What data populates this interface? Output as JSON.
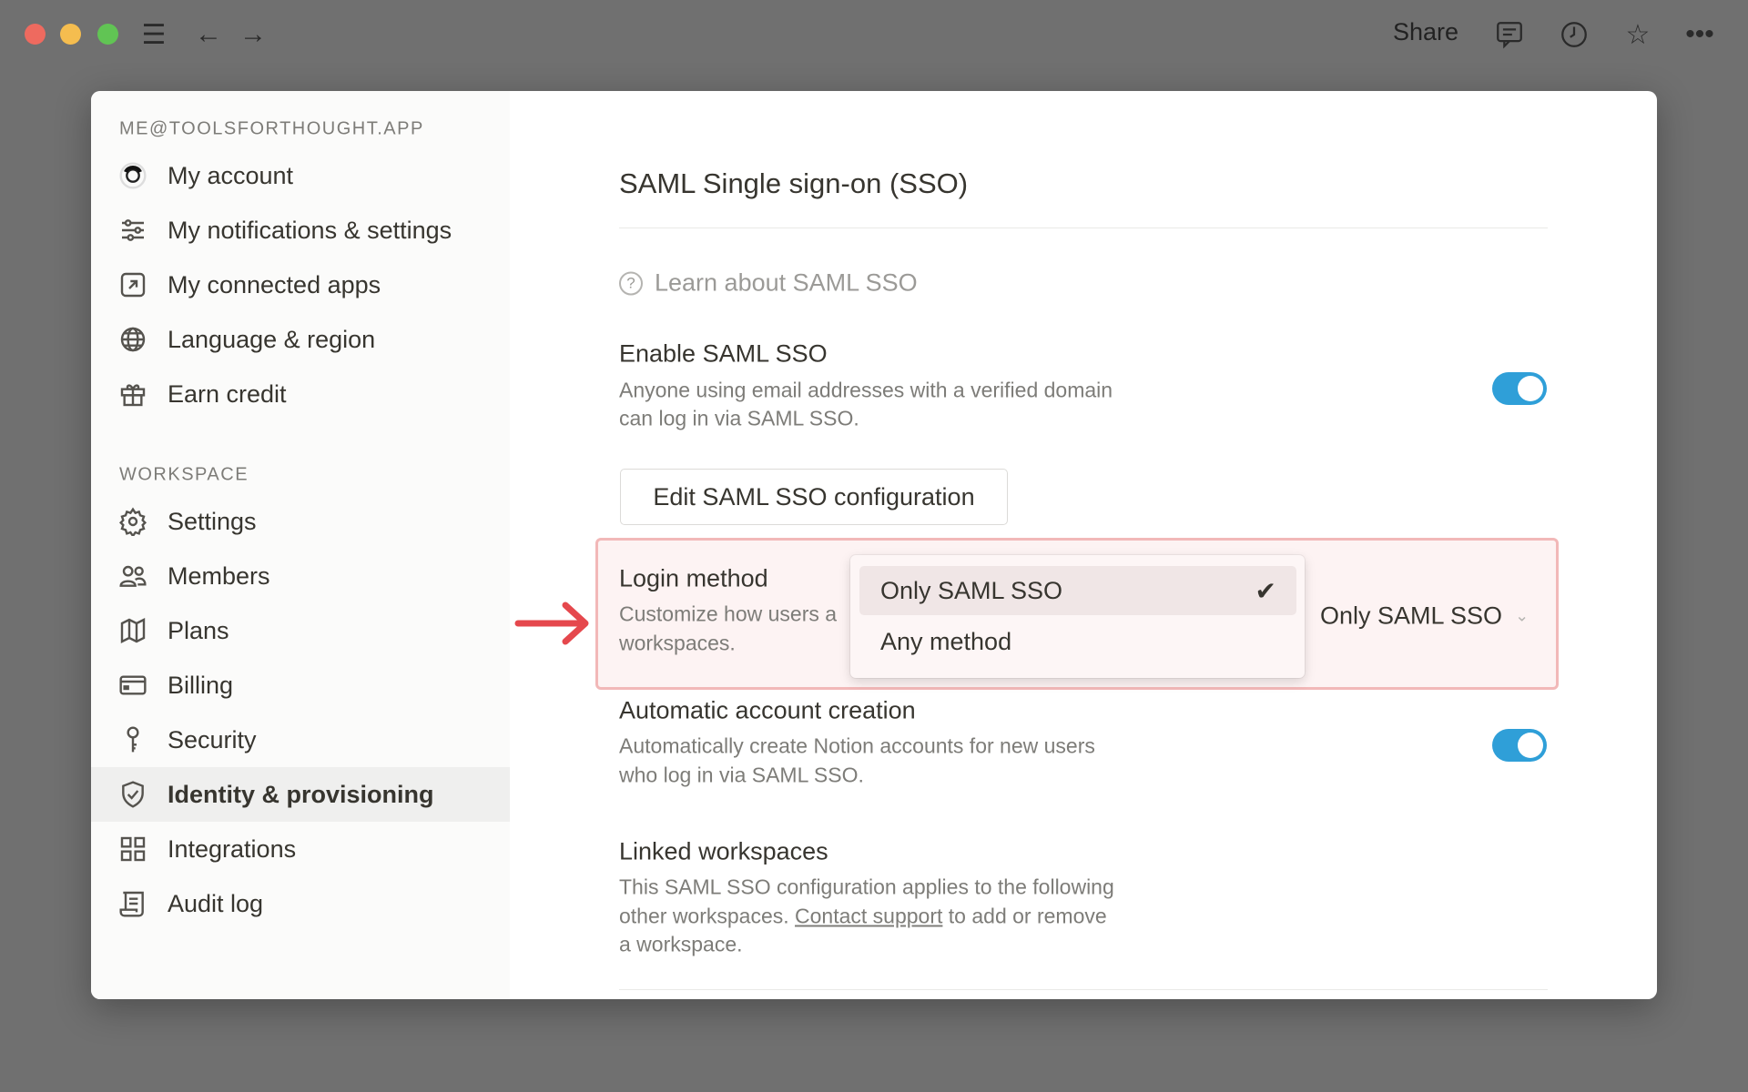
{
  "titlebar": {
    "share_label": "Share",
    "icons": [
      "hamburger-icon",
      "back-arrow-icon",
      "forward-arrow-icon",
      "comment-icon",
      "clock-icon",
      "star-icon",
      "more-icon"
    ]
  },
  "sidebar": {
    "account_label": "ME@TOOLSFORTHOUGHT.APP",
    "account_items": [
      {
        "label": "My account",
        "icon": "avatar"
      },
      {
        "label": "My notifications & settings",
        "icon": "sliders-icon"
      },
      {
        "label": "My connected apps",
        "icon": "external-link-icon"
      },
      {
        "label": "Language & region",
        "icon": "globe-icon"
      },
      {
        "label": "Earn credit",
        "icon": "gift-icon"
      }
    ],
    "workspace_label": "WORKSPACE",
    "workspace_items": [
      {
        "label": "Settings",
        "icon": "gear-icon"
      },
      {
        "label": "Members",
        "icon": "members-icon"
      },
      {
        "label": "Plans",
        "icon": "map-icon"
      },
      {
        "label": "Billing",
        "icon": "credit-card-icon"
      },
      {
        "label": "Security",
        "icon": "key-icon"
      },
      {
        "label": "Identity & provisioning",
        "icon": "shield-icon",
        "active": true
      },
      {
        "label": "Integrations",
        "icon": "grid-icon"
      },
      {
        "label": "Audit log",
        "icon": "scroll-icon"
      }
    ]
  },
  "main": {
    "title": "SAML Single sign-on (SSO)",
    "learn_link": "Learn about SAML SSO",
    "enable": {
      "title": "Enable SAML SSO",
      "desc1": "Anyone using email addresses with a verified domain",
      "desc2": "can log in via SAML SSO.",
      "enabled": true
    },
    "edit_button": "Edit SAML SSO configuration",
    "login": {
      "title": "Login method",
      "desc1": "Customize how users a",
      "desc2": "workspaces.",
      "selected": "Only SAML SSO",
      "options": [
        "Only SAML SSO",
        "Any method"
      ]
    },
    "auto": {
      "title": "Automatic account creation",
      "desc1": "Automatically create Notion accounts for new users",
      "desc2": "who log in via SAML SSO.",
      "enabled": true
    },
    "linked": {
      "title": "Linked workspaces",
      "desc1": "This SAML SSO configuration applies to the following",
      "desc2a": "other workspaces.",
      "link": "Contact support",
      "desc2b": "to add or remove",
      "desc3": "a workspace."
    }
  },
  "colors": {
    "accent": "#2f9fd8",
    "highlight_border": "#f2b8b8",
    "arrow": "#e5484d"
  }
}
